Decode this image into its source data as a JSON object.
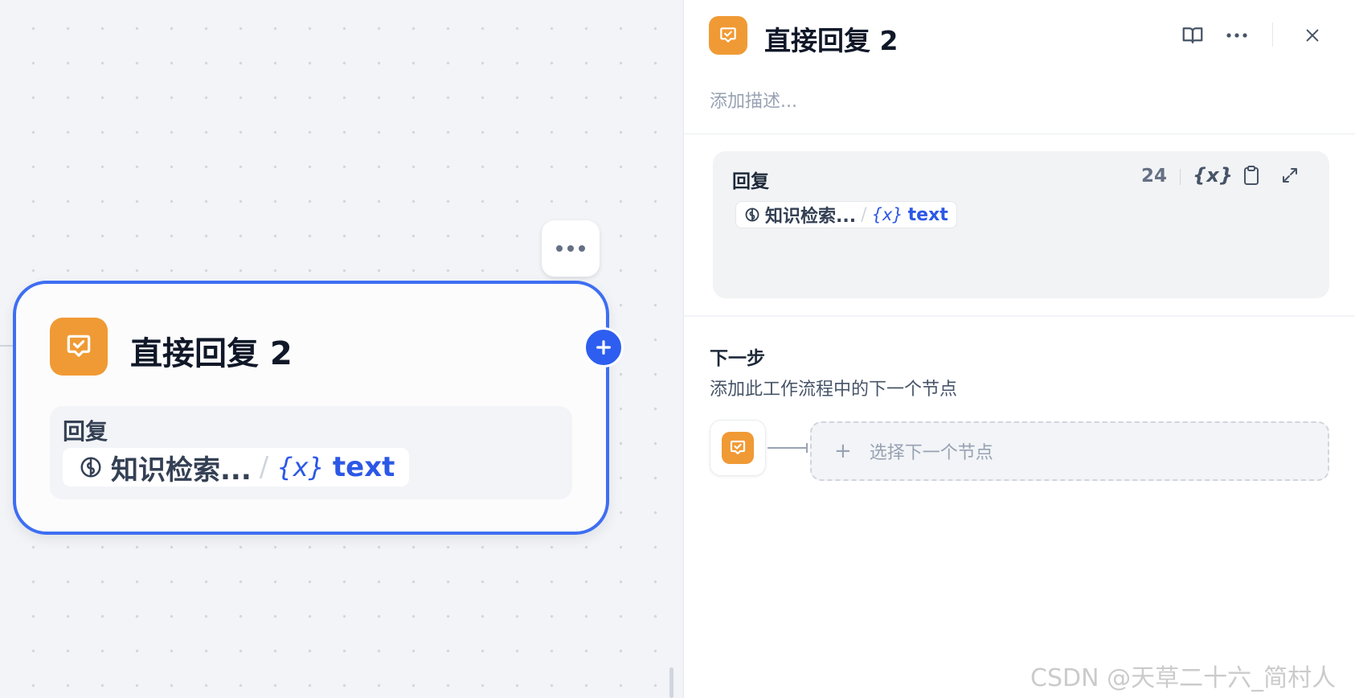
{
  "canvas": {
    "node": {
      "title": "直接回复 2",
      "body_label": "回复",
      "variable_source": "知识检索...",
      "separator": "/",
      "variable_icon": "{x}",
      "variable_name": "text"
    }
  },
  "panel": {
    "title": "直接回复 2",
    "description_placeholder": "添加描述...",
    "reply": {
      "label": "回复",
      "char_count": "24",
      "variable_icon": "{x}",
      "variable_source": "知识检索...",
      "separator": "/",
      "variable_name": "text"
    },
    "next_step": {
      "title": "下一步",
      "description": "添加此工作流程中的下一个节点",
      "select_placeholder": "选择下一个节点",
      "plus": "+"
    }
  },
  "watermark": "CSDN @天草二十六_简村人",
  "colors": {
    "accent": "#3e6ef2",
    "node_icon": "#f09a35",
    "variable": "#2c58e6"
  },
  "icons": [
    "answer-icon",
    "knowledge-retrieval-icon",
    "book-icon",
    "more-icon",
    "close-icon",
    "variable-icon",
    "clipboard-icon",
    "expand-icon",
    "plus-icon"
  ]
}
